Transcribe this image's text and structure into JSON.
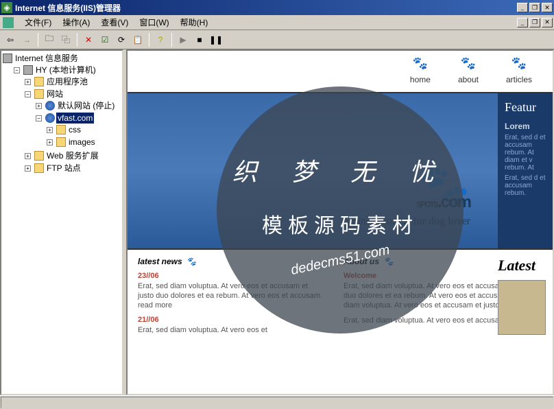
{
  "window": {
    "title": "Internet 信息服务(IIS)管理器"
  },
  "menu": {
    "file": "文件(F)",
    "action": "操作(A)",
    "view": "查看(V)",
    "window": "窗口(W)",
    "help": "帮助(H)"
  },
  "tree": {
    "root": "Internet 信息服务",
    "computer": "HY (本地计算机)",
    "apppool": "应用程序池",
    "sites": "网站",
    "defaultsite": "默认网站 (停止)",
    "vfast": "vfast.com",
    "css": "css",
    "images": "images",
    "webext": "Web 服务扩展",
    "ftp": "FTP 站点"
  },
  "site": {
    "nav": {
      "home": "home",
      "about": "about",
      "articles": "articles"
    },
    "hero": {
      "brand": "SPOTS",
      "dotcom": ".com",
      "tagline": "online resourse for dog lover"
    },
    "sidebar": {
      "feature": "Featur",
      "lorem": "Lorem",
      "p1": "Erat, sed d et accusam rebum. At diam et v rebum. At",
      "p2": "Erat, sed d et accusam rebum."
    },
    "latest": {
      "heading": "latest news",
      "d1": "23//06",
      "p1": "Erat, sed diam voluptua. At vero eos et accusam et justo duo dolores et ea rebum. At vero eos et accusam. read more",
      "d2": "21//06",
      "p2": "Erat, sed diam voluptua. At vero eos et"
    },
    "about": {
      "heading": "About us",
      "welcome": "Welcome",
      "p1": "Erat, sed diam voluptua. At vero eos et accusam et justo duo dolores et ea rebum. At vero eos et accusam. Erat, sed diam voluptua. At vero eos et accusam et justo duo dolores",
      "p2": "Erat, sed diam voluptua. At vero eos et accusam"
    },
    "latestcol": {
      "heading": "Latest"
    }
  },
  "watermark": {
    "l1": "织 梦 无 忧",
    "l2": "模板源码素材",
    "l3": "dedecms51.com"
  }
}
